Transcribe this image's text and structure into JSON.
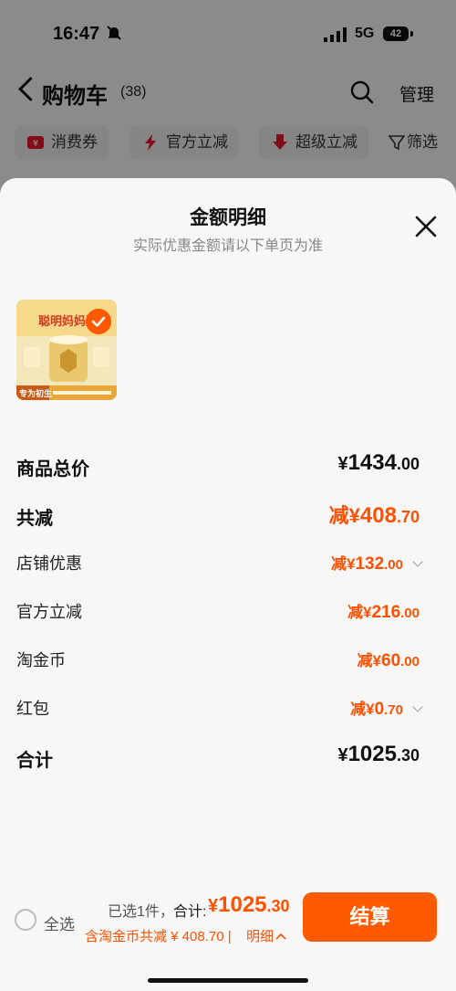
{
  "status_bar": {
    "time": "16:47",
    "network": "5G",
    "battery": "42"
  },
  "header": {
    "title": "购物车",
    "count": "(38)",
    "manage": "管理"
  },
  "chips": [
    "消费券",
    "官方立减",
    "超级立减",
    "筛选"
  ],
  "sheet": {
    "title": "金额明细",
    "subtitle": "实际优惠金额请以下单页为准",
    "product_image": {
      "banner": "聪明妈妈选",
      "tag": "专为初生"
    },
    "rows": [
      {
        "label": "商品总价",
        "prefix": "¥",
        "int": "1434",
        "dec": ".00"
      },
      {
        "label": "共减",
        "prefix": "减¥",
        "int": "408",
        "dec": ".70"
      },
      {
        "label": "店铺优惠",
        "prefix": "减¥",
        "int": "132",
        "dec": ".00"
      },
      {
        "label": "官方立减",
        "prefix": "减¥",
        "int": "216",
        "dec": ".00"
      },
      {
        "label": "淘金币",
        "prefix": "减¥",
        "int": "60",
        "dec": ".00"
      },
      {
        "label": "红包",
        "prefix": "减¥",
        "int": "0",
        "dec": ".70"
      },
      {
        "label": "合计",
        "prefix": "¥",
        "int": "1025",
        "dec": ".30"
      }
    ]
  },
  "bottom": {
    "select_all": "全选",
    "selected": "已选1件，",
    "total_label": "合计:",
    "total_prefix": "¥",
    "total_int": "1025",
    "total_dec": ".30",
    "included": "含淘金币共减 ¥ 408.70 | ",
    "detail": "明细",
    "checkout": "结算"
  },
  "colors": {
    "accent": "#ff5000",
    "button": "#ff5a00"
  }
}
